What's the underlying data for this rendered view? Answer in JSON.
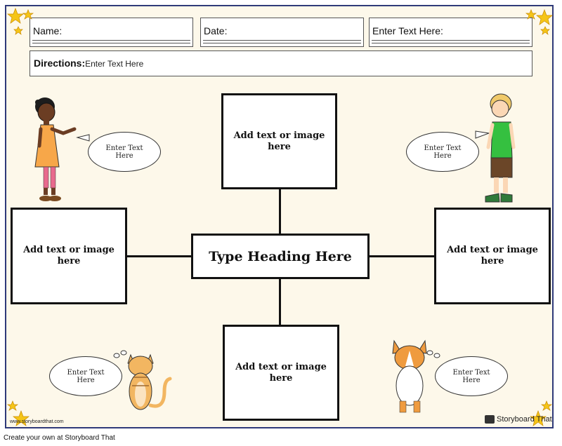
{
  "header": {
    "name_label": "Name:",
    "date_label": "Date:",
    "extra_label": "Enter Text Here:"
  },
  "directions": {
    "label": "Directions:",
    "value": "Enter Text Here"
  },
  "center_heading": "Type Heading Here",
  "boxes": {
    "top": "Add text or image here",
    "left": "Add text or image here",
    "right": "Add text or image here",
    "bottom": "Add text or image here"
  },
  "bubbles": {
    "girl": "Enter Text Here",
    "boy": "Enter Text Here",
    "cat": "Enter Text Here",
    "dog": "Enter Text Here"
  },
  "watermark": {
    "left": "www.storyboardthat.com",
    "right": "Storyboard That"
  },
  "footer": "Create your own at Storyboard That",
  "colors": {
    "border": "#2f3a79",
    "sheet_background": "#fdf8ea",
    "star": "#f5c518"
  }
}
